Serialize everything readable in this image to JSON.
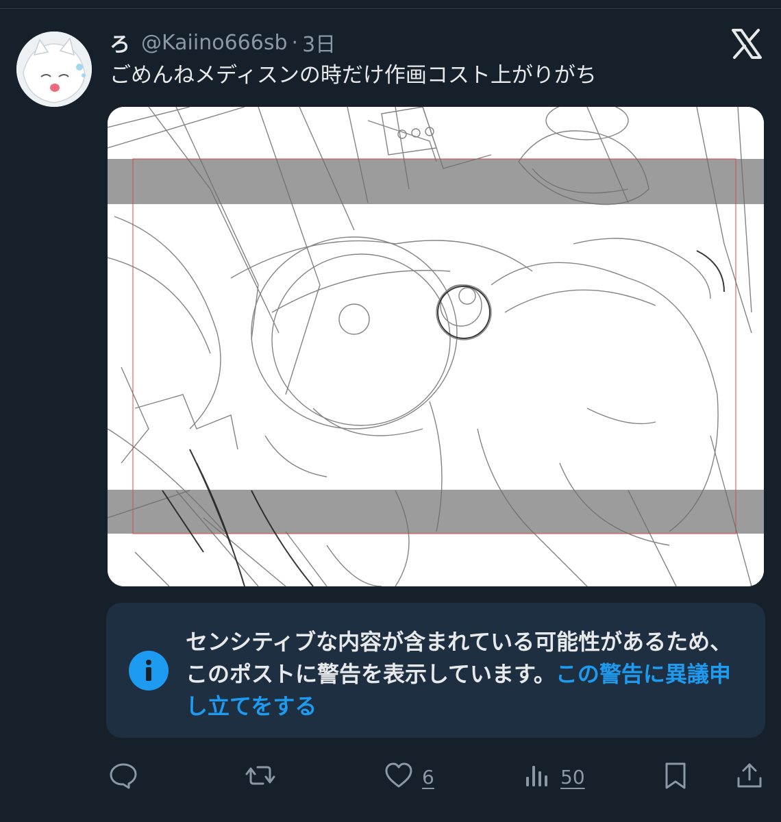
{
  "post": {
    "author": {
      "display_name": "ろ",
      "handle": "@Kaiino666sb",
      "separator": "·",
      "time": "3日"
    },
    "text": "ごめんねメディスンの時だけ作画コスト上がりがち"
  },
  "sensitive_warning": {
    "icon": "info-icon",
    "message": "センシティブな内容が含まれている可能性があるため、このポストに警告を表示しています。",
    "link_text": "この警告に異議申し立てをする"
  },
  "actions": {
    "reply": {
      "icon": "reply-icon"
    },
    "repost": {
      "icon": "repost-icon"
    },
    "like": {
      "icon": "heart-icon",
      "count": "6"
    },
    "views": {
      "icon": "views-icon",
      "count": "50"
    },
    "bookmark": {
      "icon": "bookmark-icon"
    },
    "share": {
      "icon": "share-icon"
    }
  },
  "colors": {
    "background": "#15202b",
    "accent": "#1d9bf0",
    "warning_bg": "#1e2f41",
    "secondary_text": "#8b98a5"
  }
}
